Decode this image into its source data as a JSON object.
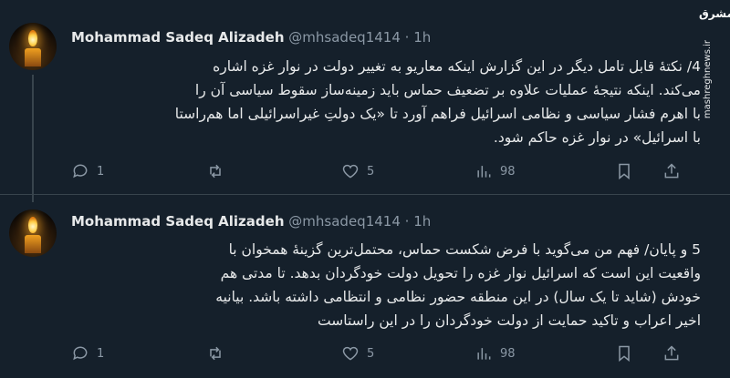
{
  "watermark": {
    "logo_text": "مشرق",
    "url": "mashreghnews.ir"
  },
  "tweets": [
    {
      "author_name": "Mohammad Sadeq Alizadeh",
      "handle": "@mhsadeq1414",
      "separator": "·",
      "time": "1h",
      "lines": [
        "4/ نکتۀ قابل تامل دیگر در این گزارش اینکه معاریو به تغییر دولت در نوار غزه اشاره",
        "می‌کند. اینکه نتیجۀ عملیات علاوه بر تضعیف حماس باید زمینه‌ساز سقوط سیاسی آن را",
        "با اهرم فشار سیاسی و نظامی اسرائیل فراهم آورد تا «یک دولتِ غیراسرائیلی اما هم‌راستا",
        "با اسرائیل» در نوار غزه حاکم شود."
      ],
      "replies": "1",
      "retweets": "",
      "likes": "5",
      "views": "98"
    },
    {
      "author_name": "Mohammad Sadeq Alizadeh",
      "handle": "@mhsadeq1414",
      "separator": "·",
      "time": "1h",
      "lines": [
        "5 و پایان/ فهم من می‌گوید با فرض شکست حماس، محتمل‌ترین گزینۀ همخوان با",
        "واقعیت این است که اسرائیل نوار غزه را تحویل دولت خودگردان بدهد. تا مدتی هم",
        "خودش (شاید تا یک سال) در این منطقه حضور نظامی و انتظامی داشته باشد. بیانیه",
        "اخیر اعراب و تاکید حمایت از دولت خودگردان را در این راستاست"
      ],
      "replies": "1",
      "retweets": "",
      "likes": "5",
      "views": "98"
    }
  ],
  "icons": {
    "reply": "reply-icon",
    "retweet": "retweet-icon",
    "like": "heart-icon",
    "views": "views-icon",
    "bookmark": "bookmark-icon",
    "share": "share-icon"
  },
  "colors": {
    "background": "#15202b",
    "text": "#e7e9ea",
    "muted": "#8b98a5",
    "divider": "#38444d"
  }
}
